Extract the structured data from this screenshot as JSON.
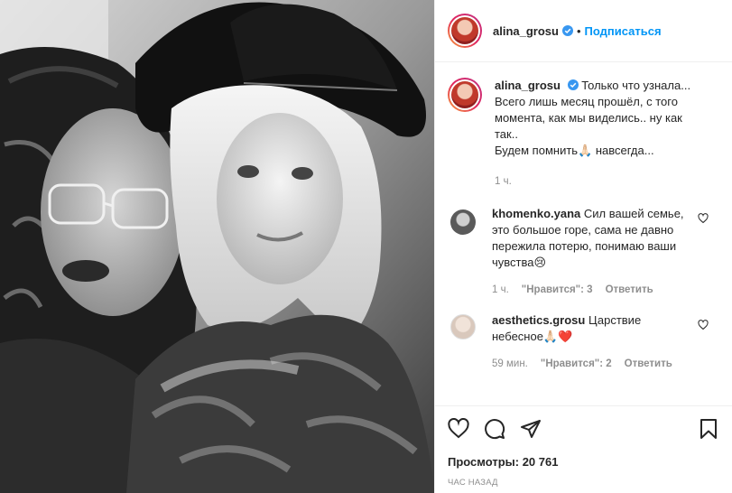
{
  "header": {
    "username": "alina_grosu",
    "separator": "•",
    "follow_label": "Подписаться"
  },
  "caption": {
    "username": "alina_grosu",
    "lines": [
      "Только что узнала...",
      "Всего лишь месяц прошёл, с того",
      "момента, как мы виделись.. ну как",
      "так..",
      "Будем помнить🙏🏻 навсегда..."
    ],
    "time": "1 ч."
  },
  "comments": [
    {
      "username": "khomenko.yana",
      "text": "Сил вашей семье, это большое горе, сама не давно пережила потерю, понимаю ваши чувства😢",
      "time": "1 ч.",
      "likes_label": "\"Нравится\": 3",
      "reply_label": "Ответить"
    },
    {
      "username": "aesthetics.grosu",
      "text": "Царствие небесное🙏🏻❤️",
      "time": "59 мин.",
      "likes_label": "\"Нравится\": 2",
      "reply_label": "Ответить"
    }
  ],
  "actions": {
    "icons": [
      "heart-icon",
      "comment-icon",
      "share-icon",
      "bookmark-icon"
    ],
    "views_label": "Просмотры: 20 761",
    "posted_time": "час назад"
  },
  "colors": {
    "accent": "#0095f6",
    "verified": "#3897f0",
    "secondary_text": "#8e8e8e",
    "border": "#efefef"
  }
}
